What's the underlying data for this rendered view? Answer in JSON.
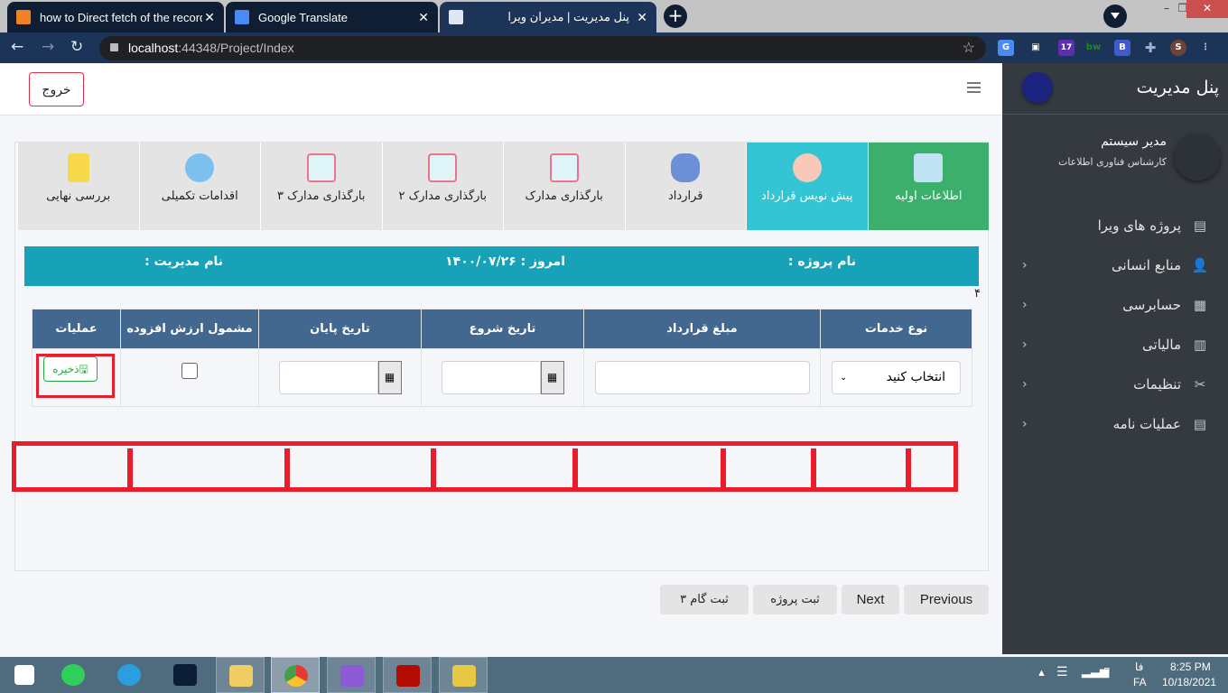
{
  "browser": {
    "tabs": [
      {
        "title": "how to Direct fetch of the record",
        "icon": "stackoverflow-icon"
      },
      {
        "title": "Google Translate",
        "icon": "google-translate-icon"
      },
      {
        "title": "پنل مدیریت | مدیران ویرا",
        "icon": "page-icon",
        "active": true
      }
    ],
    "new_tab": "+",
    "url_host": "localhost",
    "url_rest": ":44348/Project/Index",
    "extensions": [
      "google-translate-ext",
      "ext-2",
      "ext-17",
      "bitwarden-ext",
      "ext-b",
      "puzzle-icon"
    ],
    "extension_badge": "17",
    "extension_bw": "bw",
    "extension_b": "B",
    "profile_initial": "S"
  },
  "header": {
    "logout_label": "خروج"
  },
  "sidebar": {
    "brand": "پنل مدیریت",
    "user_name": "مدیر سیستم",
    "user_role": "کارشناس فناوری اطلاعات",
    "items": [
      {
        "label": "پروژه های ویرا",
        "icon": "list-icon",
        "has_children": false
      },
      {
        "label": "منابع انسانی",
        "icon": "user-plus-icon",
        "has_children": true
      },
      {
        "label": "حسابرسی",
        "icon": "calculator-icon",
        "has_children": true
      },
      {
        "label": "مالیاتی",
        "icon": "bar-chart-icon",
        "has_children": true
      },
      {
        "label": "تنظیمات",
        "icon": "tools-icon",
        "has_children": true
      },
      {
        "label": "عملیات نامه",
        "icon": "list-icon",
        "has_children": true
      }
    ]
  },
  "steps": [
    {
      "label": "اطلاعات اولیه",
      "state": "done",
      "color": "#3daf6c"
    },
    {
      "label": "پیش نویس قرارداد",
      "state": "current",
      "color": "#33c5d4"
    },
    {
      "label": "قرارداد",
      "state": "pending"
    },
    {
      "label": "بارگذاری مدارک",
      "state": "pending"
    },
    {
      "label": "بارگذاری مدارک ۲",
      "state": "pending"
    },
    {
      "label": "بارگذاری مدارک ۳",
      "state": "pending"
    },
    {
      "label": "اقدامات تکمیلی",
      "state": "pending"
    },
    {
      "label": "بررسی نهایی",
      "state": "pending"
    }
  ],
  "info": {
    "project_name": "نام پروژه :",
    "today": "امروز : ۱۴۰۰/۰۷/۲۶",
    "manager_name": "نام مدیریت :"
  },
  "counter": "۴",
  "table": {
    "headers": [
      "نوع خدمات",
      "مبلغ قرارداد",
      "تاریخ شروع",
      "تاریخ پایان",
      "مشمول ارزش افزوده",
      "عملیات"
    ],
    "row": {
      "service_type": "انتخاب کنید",
      "amount": "",
      "start_date": "",
      "end_date": "",
      "vat_included": false,
      "save_label": "ذخیره"
    }
  },
  "pager": {
    "previous": "Previous",
    "next": "Next",
    "submit_project": "ثبت پروژه",
    "submit_step3": "ثبت گام ۳"
  },
  "taskbar": {
    "apps": [
      "windows-start",
      "whatsapp",
      "telegram",
      "photoshop",
      "file-explorer",
      "chrome",
      "visual-studio",
      "acrobat",
      "db-tool"
    ],
    "lang_top": "فا",
    "lang": "FA",
    "time": "8:25 PM",
    "date": "10/18/2021"
  },
  "colors": {
    "accent_teal": "#17a2b8",
    "table_header": "#436890",
    "sidebar": "#343a40",
    "danger": "#dc3545",
    "success": "#28a745"
  }
}
